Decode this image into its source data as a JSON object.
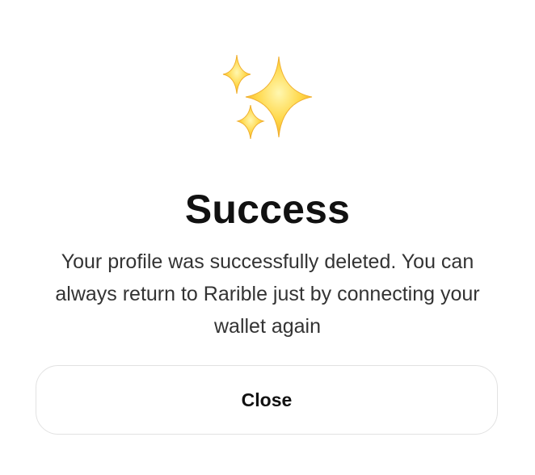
{
  "icon": "sparkles-icon",
  "colors": {
    "sparkle_light": "#FFE36B",
    "sparkle_dark": "#F5B52A",
    "title": "#111111",
    "message": "#333333",
    "button_border": "#E2E2E2"
  },
  "dialog": {
    "title": "Success",
    "message": "Your profile was successfully deleted. You can always return to Rarible just by connecting your wallet again",
    "close_label": "Close"
  }
}
